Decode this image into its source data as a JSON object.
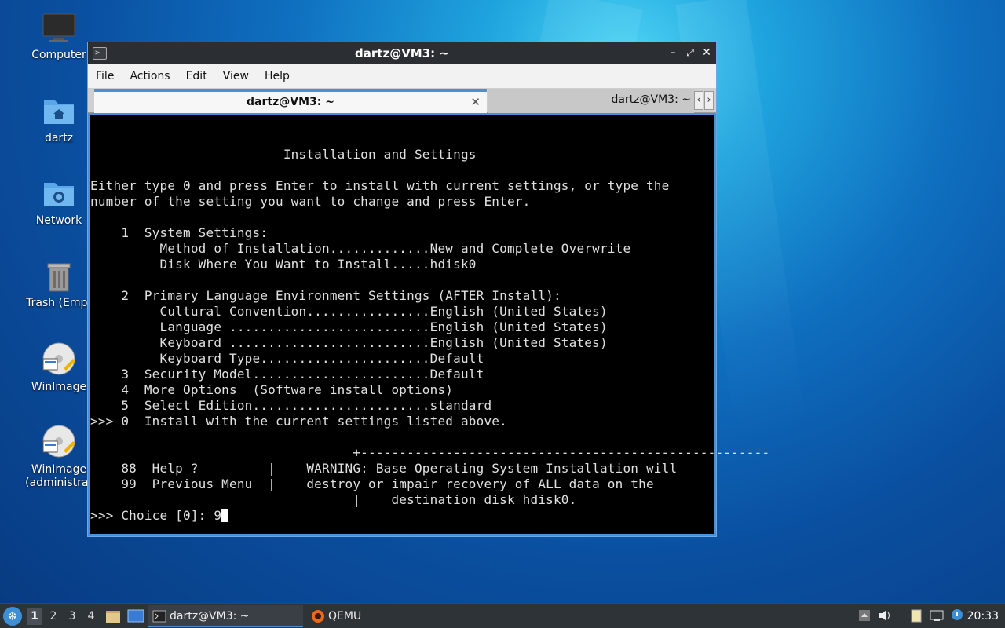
{
  "desktop": {
    "icons": [
      {
        "label": "Computer",
        "icon": "monitor-icon"
      },
      {
        "label": "dartz",
        "icon": "home-folder-icon"
      },
      {
        "label": "Network",
        "icon": "network-folder-icon"
      },
      {
        "label": "Trash (Empt",
        "icon": "trash-icon"
      },
      {
        "label": "WinImage",
        "icon": "winimage-icon"
      },
      {
        "label": "WinImage\n(administrat",
        "icon": "winimage-icon"
      }
    ]
  },
  "window": {
    "title": "dartz@VM3: ~",
    "menu": [
      "File",
      "Actions",
      "Edit",
      "View",
      "Help"
    ],
    "tabs": {
      "active": "dartz@VM3: ~",
      "inactive": "dartz@VM3: ~"
    },
    "terminal_lines": [
      "",
      "",
      "                         Installation and Settings",
      "",
      "Either type 0 and press Enter to install with current settings, or type the",
      "number of the setting you want to change and press Enter.",
      "",
      "    1  System Settings:",
      "         Method of Installation.............New and Complete Overwrite",
      "         Disk Where You Want to Install.....hdisk0",
      "",
      "    2  Primary Language Environment Settings (AFTER Install):",
      "         Cultural Convention................English (United States)",
      "         Language ..........................English (United States)",
      "         Keyboard ..........................English (United States)",
      "         Keyboard Type......................Default",
      "    3  Security Model.......................Default",
      "    4  More Options  (Software install options)",
      "    5  Select Edition.......................standard",
      ">>> 0  Install with the current settings listed above.",
      "",
      "                                  +-----------------------------------------------------",
      "    88  Help ?         |    WARNING: Base Operating System Installation will",
      "    99  Previous Menu  |    destroy or impair recovery of ALL data on the",
      "                                  |    destination disk hdisk0."
    ],
    "prompt": ">>> Choice [0]: 9"
  },
  "taskbar": {
    "workspaces": [
      "1",
      "2",
      "3",
      "4"
    ],
    "active_workspace": "1",
    "apps": [
      {
        "label": "dartz@VM3: ~",
        "icon": "terminal-icon"
      },
      {
        "label": "QEMU",
        "icon": "qemu-icon"
      }
    ],
    "clock": "20:33"
  }
}
